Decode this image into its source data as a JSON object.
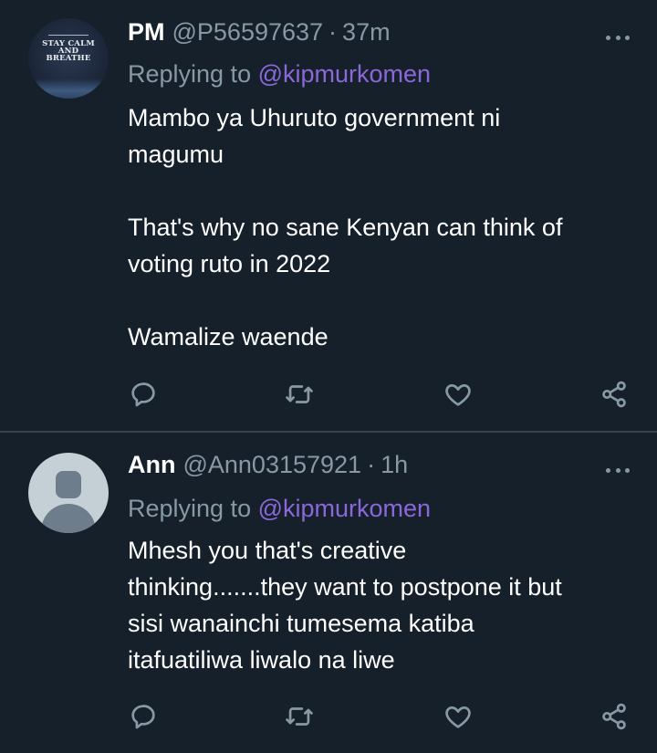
{
  "theme": {
    "background": "#15202b",
    "text": "#ffffff",
    "muted": "#8899a6",
    "mention": "#8b68d8",
    "divider": "#38444d"
  },
  "tweets": [
    {
      "name": "PM",
      "handle": "@P56597637",
      "separator": "·",
      "time": "37m",
      "replying_prefix": "Replying to",
      "replying_to": "@kipmurkomen",
      "avatar_text": [
        "STAY CALM",
        "AND",
        "BREATHE"
      ],
      "lines": [
        "Mambo ya Uhuruto government ni",
        "magumu",
        "",
        "That's why no sane Kenyan can think of",
        "voting ruto in 2022",
        "",
        "Wamalize waende"
      ]
    },
    {
      "name": "Ann",
      "handle": "@Ann03157921",
      "separator": "·",
      "time": "1h",
      "replying_prefix": "Replying to",
      "replying_to": "@kipmurkomen",
      "lines": [
        "Mhesh you that's creative",
        "thinking.......they want to postpone it but",
        "sisi wanainchi tumesema katiba",
        "itafuatiliwa liwalo na liwe"
      ]
    }
  ],
  "icons": {
    "reply": "reply-icon",
    "retweet": "retweet-icon",
    "like": "heart-icon",
    "share": "share-icon",
    "more": "more-icon"
  }
}
